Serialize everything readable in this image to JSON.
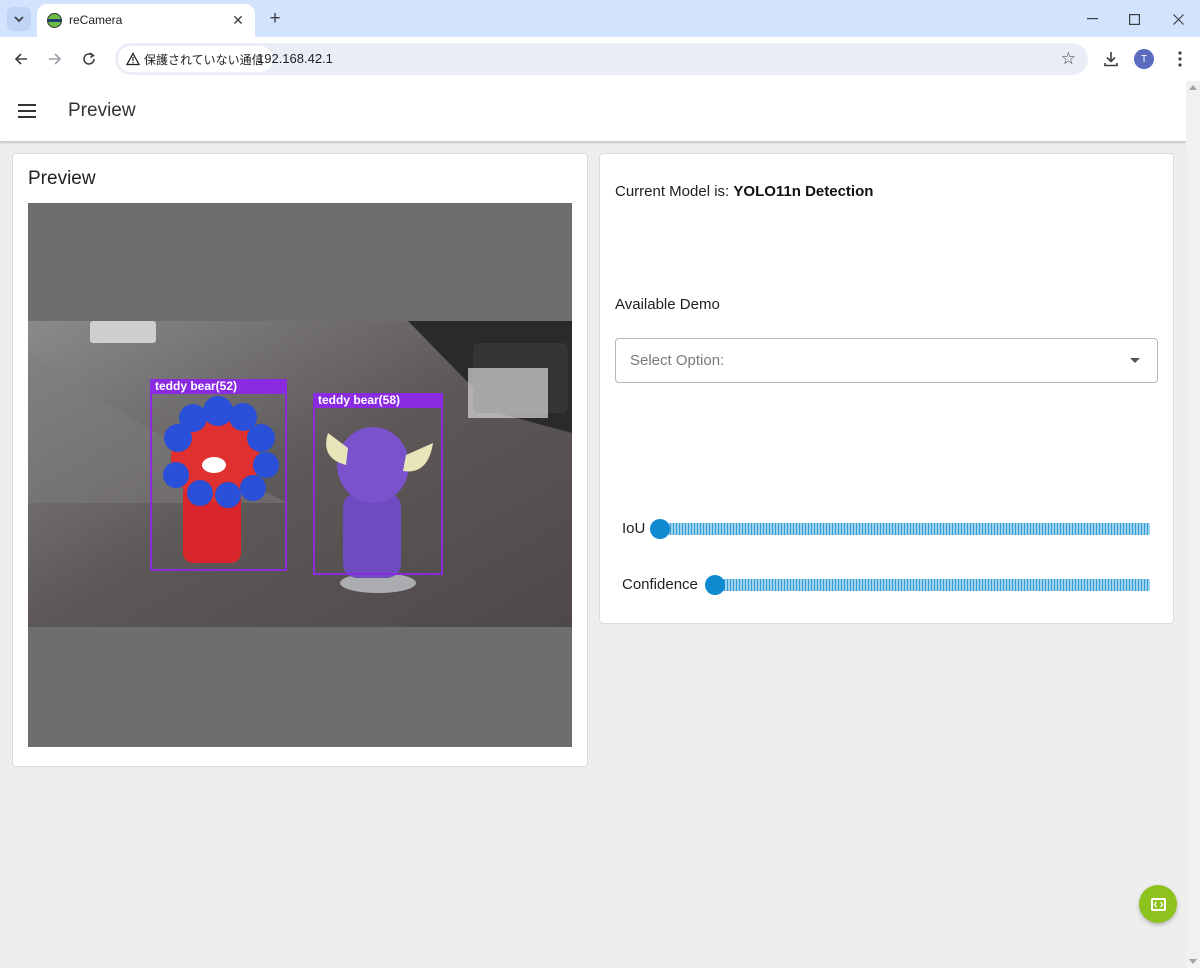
{
  "browser": {
    "tab_title": "reCamera",
    "security_label": "保護されていない通信",
    "url": "192.168.42.1",
    "avatar_letter": "T",
    "new_tab_symbol": "+",
    "tab_close_symbol": "✕",
    "window_controls": [
      "—",
      "☐",
      "✕"
    ]
  },
  "appbar": {
    "title": "Preview"
  },
  "preview": {
    "title": "Preview",
    "detections": [
      {
        "label": "teddy bear(52)"
      },
      {
        "label": "teddy bear(58)"
      }
    ]
  },
  "controls": {
    "model_prefix": "Current Model is:",
    "model_name": "YOLO11n Detection",
    "demo_label": "Available Demo",
    "select_placeholder": "Select Option:",
    "sliders": [
      {
        "label": "IoU",
        "value": 0
      },
      {
        "label": "Confidence",
        "value": 0
      }
    ]
  },
  "colors": {
    "accent_slider": "#0f8ad0",
    "detection_box": "#8a2be2",
    "fab": "#8dc21f"
  },
  "icons": [
    "tab-search-icon",
    "favicon-icon",
    "back-icon",
    "forward-icon",
    "reload-icon",
    "warning-icon",
    "bookmark-star-icon",
    "download-icon",
    "more-vert-icon",
    "hamburger-menu-icon",
    "dropdown-caret-icon",
    "code-icon"
  ]
}
